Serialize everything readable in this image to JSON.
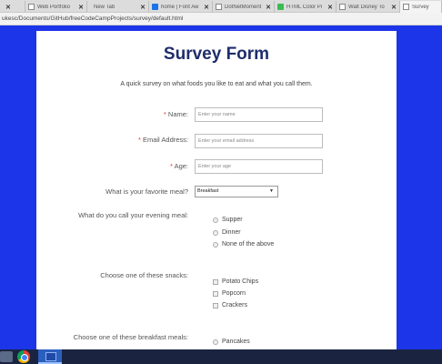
{
  "browser": {
    "tabs": [
      {
        "label": "",
        "icon": "page-icon"
      },
      {
        "label": "Web Portfolio",
        "icon": "page-icon"
      },
      {
        "label": "New Tab",
        "icon": "none"
      },
      {
        "label": "home | Font Aw",
        "icon": "fontawesome-icon"
      },
      {
        "label": "DotNetMoment",
        "icon": "page-icon"
      },
      {
        "label": "HTML Color Pi",
        "icon": "color-picker-icon"
      },
      {
        "label": "Walt Disney To",
        "icon": "page-icon"
      },
      {
        "label": "Survey",
        "icon": "page-icon"
      }
    ],
    "address": "ukesc/Documents/GitHub/freeCodeCampProjects/survey/default.html"
  },
  "page": {
    "title": "Survey Form",
    "description": "A quick survey on what foods you like to eat and what you call them.",
    "fields": {
      "name_label": "Name:",
      "name_placeholder": "Enter your name",
      "email_label": "Email Address:",
      "email_placeholder": "Enter your email address",
      "age_label": "Age:",
      "age_placeholder": "Enter your age",
      "required_mark": "* "
    },
    "meal": {
      "label": "What is your favorite meal?",
      "selected": "Breakfast"
    },
    "evening": {
      "label": "What do you call your evening meal:",
      "options": [
        "Supper",
        "Dinner",
        "None of the above"
      ]
    },
    "snacks": {
      "label": "Choose one of these snacks:",
      "options": [
        "Potato Chips",
        "Popcorn",
        "Crackers"
      ]
    },
    "breakfast": {
      "label": "Choose one of these breakfast meals:",
      "options": [
        "Pancakes"
      ]
    }
  },
  "colors": {
    "background": "#1c35e8",
    "title": "#1f2d6b",
    "required": "#d33333"
  }
}
